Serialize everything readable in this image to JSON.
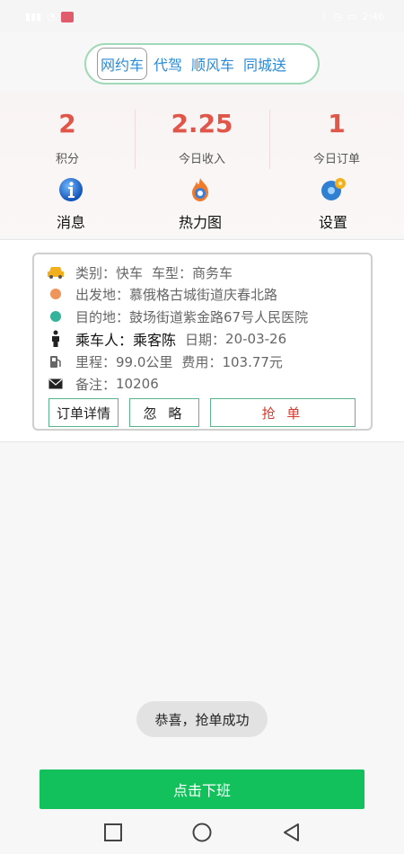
{
  "status_bar": {
    "left_text": "",
    "right_text": "2:46"
  },
  "header": {
    "tabs": [
      {
        "label": "网约车",
        "active": true
      },
      {
        "label": "代驾",
        "active": false
      },
      {
        "label": "顺风车",
        "active": false
      },
      {
        "label": "同城送",
        "active": false
      }
    ]
  },
  "stats": [
    {
      "value": "2",
      "label": "积分"
    },
    {
      "value": "2.25",
      "label": "今日收入"
    },
    {
      "value": "1",
      "label": "今日订单"
    }
  ],
  "actions": [
    {
      "label": "消息",
      "icon": "info-icon"
    },
    {
      "label": "热力图",
      "icon": "flame-icon"
    },
    {
      "label": "设置",
      "icon": "settings-icon"
    }
  ],
  "order": {
    "category_label": "类别：",
    "category_value": "快车",
    "car_type_label": "车型：",
    "car_type_value": "商务车",
    "departure_label": "出发地：",
    "departure_value": "慕俄格古城街道庆春北路",
    "destination_label": "目的地：",
    "destination_value": "鼓场街道紫金路67号人民医院",
    "passenger_label": "乘车人：",
    "passenger_value": "乘客陈",
    "date_label": "日期：",
    "date_value": "20-03-26",
    "mileage_label": "里程：",
    "mileage_value": "99.0公里",
    "fee_label": "费用：",
    "fee_value": "103.77元",
    "note_label": "备注：",
    "note_value": "10206",
    "buttons": {
      "details": "订单详情",
      "ignore": "忽 略",
      "grab": "抢 单"
    }
  },
  "toast": "恭喜，抢单成功",
  "off_duty_button": "点击下班",
  "colors": {
    "accent_green": "#12c15c",
    "stat_red": "#e0574a",
    "tab_blue": "#2a8ad6",
    "departure_dot": "#f0955a",
    "destination_dot": "#33b39a"
  }
}
